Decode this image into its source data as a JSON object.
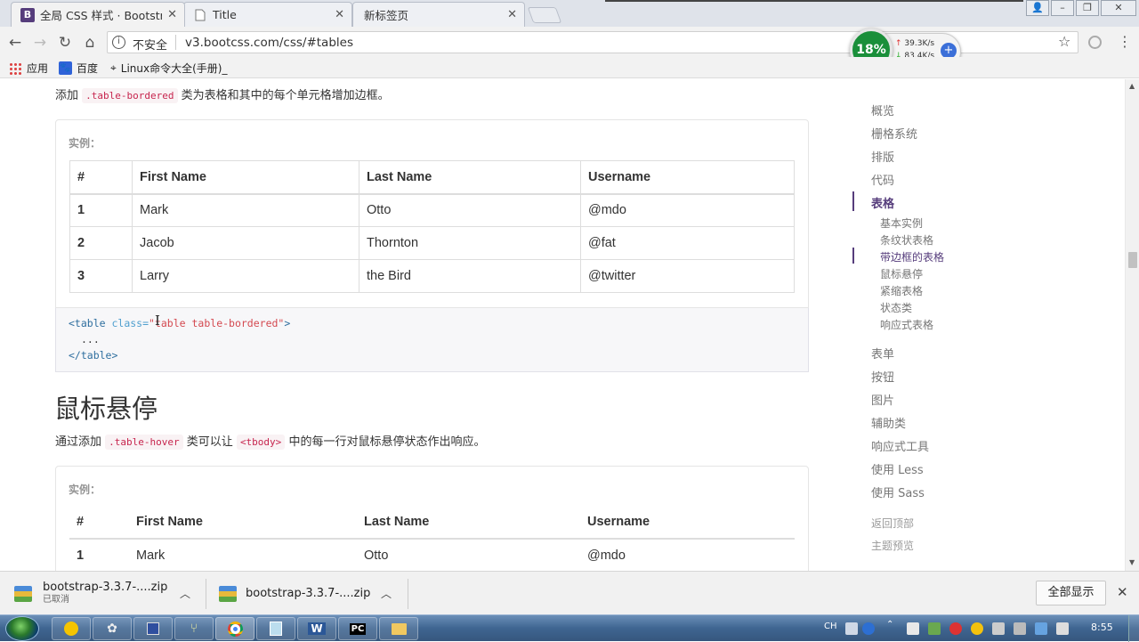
{
  "tabs": [
    {
      "title": "全局 CSS 样式 · Bootstra",
      "favicon": "B",
      "active": true
    },
    {
      "title": "Title",
      "active": false
    },
    {
      "title": "新标签页",
      "active": false
    }
  ],
  "toolbar": {
    "security": "不安全",
    "url": "v3.bootcss.com/css/#tables"
  },
  "speed_widget": {
    "percent": "18%",
    "up": "39.3K/s",
    "down": "83.4K/s"
  },
  "bookmarks": [
    {
      "label": "应用",
      "icon": "apps-grid-icon"
    },
    {
      "label": "百度",
      "icon": "baidu-paw-icon"
    },
    {
      "label": "Linux命令大全(手册)_",
      "icon": "linux-command-icon"
    }
  ],
  "content": {
    "bordered_intro_before": "添加",
    "bordered_intro_code": ".table-bordered",
    "bordered_intro_after": "类为表格和其中的每个单元格增加边框。",
    "example_label": "实例：",
    "table_headers": [
      "#",
      "First Name",
      "Last Name",
      "Username"
    ],
    "table_rows": [
      [
        "1",
        "Mark",
        "Otto",
        "@mdo"
      ],
      [
        "2",
        "Jacob",
        "Thornton",
        "@fat"
      ],
      [
        "3",
        "Larry",
        "the Bird",
        "@twitter"
      ]
    ],
    "code": {
      "open_tag": "<table",
      "attr": "class=",
      "value": "\"table table-bordered\"",
      "close_bracket": ">",
      "ellipsis": "...",
      "end_tag": "</table>"
    },
    "hover_heading": "鼠标悬停",
    "hover_intro_before": "通过添加",
    "hover_intro_code1": ".table-hover",
    "hover_intro_mid": "类可以让",
    "hover_intro_code2": "<tbody>",
    "hover_intro_after": "中的每一行对鼠标悬停状态作出响应。"
  },
  "sidebar": {
    "items": [
      "概览",
      "栅格系统",
      "排版",
      "代码",
      "表格"
    ],
    "subitems": [
      "基本实例",
      "条纹状表格",
      "带边框的表格",
      "鼠标悬停",
      "紧缩表格",
      "状态类",
      "响应式表格"
    ],
    "items_after": [
      "表单",
      "按钮",
      "图片",
      "辅助类",
      "响应式工具",
      "使用 Less",
      "使用 Sass"
    ],
    "bottom": [
      "返回顶部",
      "主题预览"
    ]
  },
  "downloads": [
    {
      "filename": "bootstrap-3.3.7-....zip",
      "status": "已取消"
    },
    {
      "filename": "bootstrap-3.3.7-....zip",
      "status": ""
    }
  ],
  "download_bar": {
    "show_all": "全部显示"
  },
  "taskbar": {
    "ime": "CH",
    "time": "8:55"
  },
  "colors": {
    "bootstrap_purple": "#563d7c",
    "code_red": "#c7254e",
    "taskbar_blue": "#3f6591",
    "speed_green": "#1a8f3a"
  }
}
